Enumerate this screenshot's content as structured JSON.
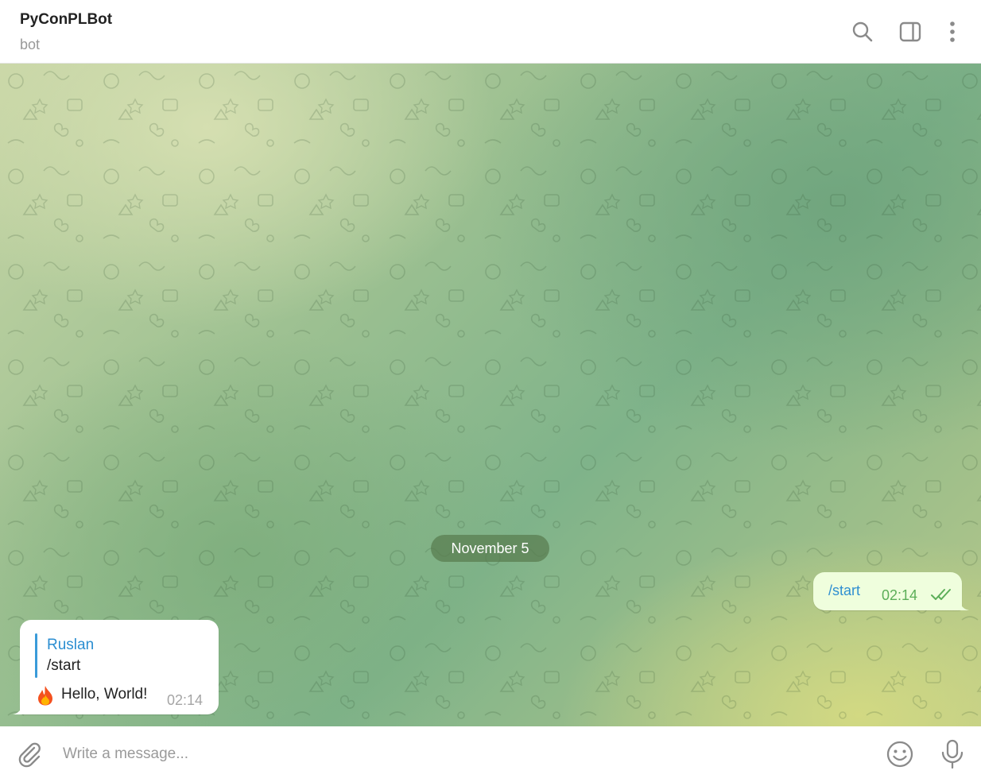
{
  "header": {
    "title": "PyConPLBot",
    "subtitle": "bot",
    "icons": [
      "search-icon",
      "sidebar-toggle-icon",
      "more-vertical-icon"
    ]
  },
  "chat": {
    "date_separator": "November 5",
    "messages": [
      {
        "direction": "outgoing",
        "text": "/start",
        "time": "02:14",
        "status": "read"
      },
      {
        "direction": "incoming",
        "reply_to": {
          "author": "Ruslan",
          "text": "/start"
        },
        "emoji": "🔥",
        "text": "Hello, World!",
        "time": "02:14"
      }
    ]
  },
  "composer": {
    "placeholder": "Write a message...",
    "value": "",
    "icons": [
      "paperclip-icon",
      "emoji-icon",
      "microphone-icon"
    ]
  },
  "colors": {
    "outgoing_bubble": "#effedd",
    "incoming_bubble": "#ffffff",
    "link_blue": "#2f8fd1",
    "read_check_green": "#5cae58",
    "date_pill": "#5a7d50"
  }
}
